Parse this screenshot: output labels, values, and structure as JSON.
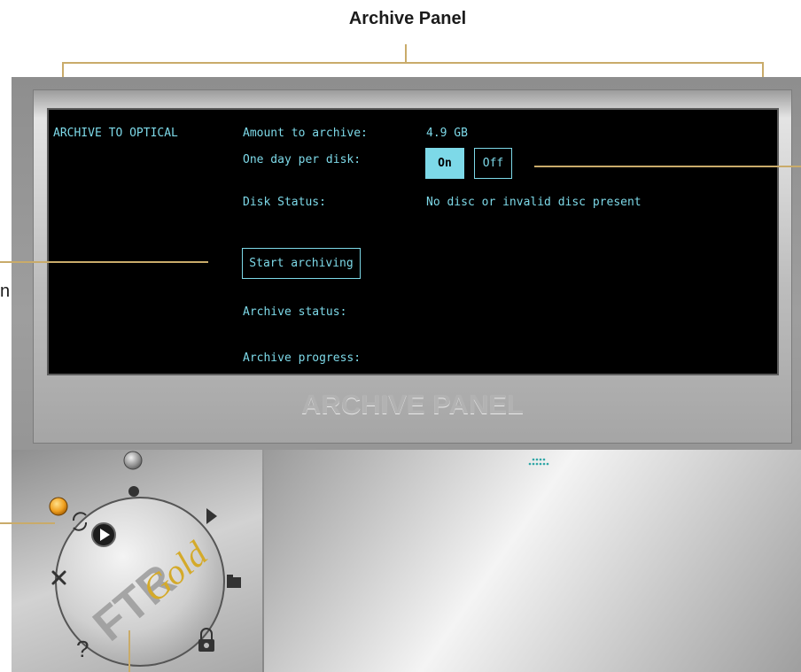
{
  "callout": {
    "title": "Archive Panel",
    "left_label_fragment": "n"
  },
  "screen": {
    "section_title": "ARCHIVE TO OPTICAL",
    "amount_label": "Amount to archive:",
    "amount_value": "4.9 GB",
    "one_day_label": "One day per disk:",
    "on_button": "On",
    "off_button": "Off",
    "disk_status_label": "Disk Status:",
    "disk_status_value": "No disc or invalid disc present",
    "start_button": "Start archiving",
    "archive_status_label": "Archive status:",
    "archive_progress_label": "Archive progress:"
  },
  "panel_label": "ARCHIVE PANEL",
  "dial": {
    "brand": "FTR",
    "brand_sub": "Gold",
    "help_glyph": "?",
    "icons": [
      "record-icon",
      "play-icon",
      "folder-icon",
      "lock-icon",
      "help-icon",
      "tools-icon",
      "refresh-icon"
    ]
  },
  "colors": {
    "screen_text": "#7dd9e8",
    "screen_bg": "#000000",
    "callout_line": "#c9ab6a",
    "indicator_led": "#f0a020"
  }
}
